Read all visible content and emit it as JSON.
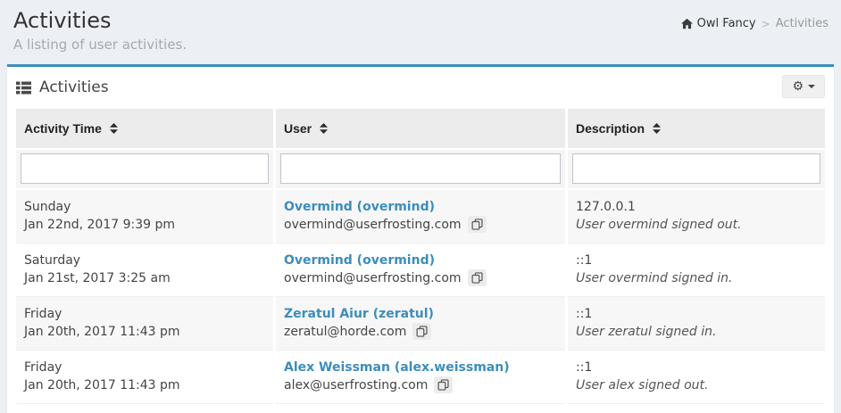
{
  "page": {
    "title": "Activities",
    "subtitle": "A listing of user activities.",
    "breadcrumb": {
      "home_icon": "home-icon",
      "root": "Owl Fancy",
      "separator": ">",
      "current": "Activities"
    }
  },
  "panel": {
    "title": "Activities",
    "title_icon": "th-list-icon",
    "settings_icon": "gear-icon",
    "settings_caret_icon": "caret-down-icon"
  },
  "table": {
    "columns": [
      {
        "label": "Activity Time",
        "sort_icon": "sort-icon"
      },
      {
        "label": "User",
        "sort_icon": "sort-icon"
      },
      {
        "label": "Description",
        "sort_icon": "sort-icon"
      }
    ],
    "filters": [
      {
        "value": "",
        "placeholder": ""
      },
      {
        "value": "",
        "placeholder": ""
      },
      {
        "value": "",
        "placeholder": ""
      }
    ],
    "rows": [
      {
        "day": "Sunday",
        "date": "Jan 22nd, 2017 9:39 pm",
        "user_name": "Overmind (overmind)",
        "email": "overmind@userfrosting.com",
        "copy_icon": "clone-icon",
        "ip": "127.0.0.1",
        "description": "User overmind signed out."
      },
      {
        "day": "Saturday",
        "date": "Jan 21st, 2017 3:25 am",
        "user_name": "Overmind (overmind)",
        "email": "overmind@userfrosting.com",
        "copy_icon": "clone-icon",
        "ip": "::1",
        "description": "User overmind signed in."
      },
      {
        "day": "Friday",
        "date": "Jan 20th, 2017 11:43 pm",
        "user_name": "Zeratul Aiur (zeratul)",
        "email": "zeratul@horde.com",
        "copy_icon": "clone-icon",
        "ip": "::1",
        "description": "User zeratul signed in."
      },
      {
        "day": "Friday",
        "date": "Jan 20th, 2017 11:43 pm",
        "user_name": "Alex Weissman (alex.weissman)",
        "email": "alex@userfrosting.com",
        "copy_icon": "clone-icon",
        "ip": "::1",
        "description": "User alex signed out."
      }
    ]
  },
  "colors": {
    "accent_blue": "#3c8dbc",
    "page_background": "#ecf0f5",
    "header_cell_background": "#ececec",
    "striped_row_background": "#f7f7f7"
  }
}
